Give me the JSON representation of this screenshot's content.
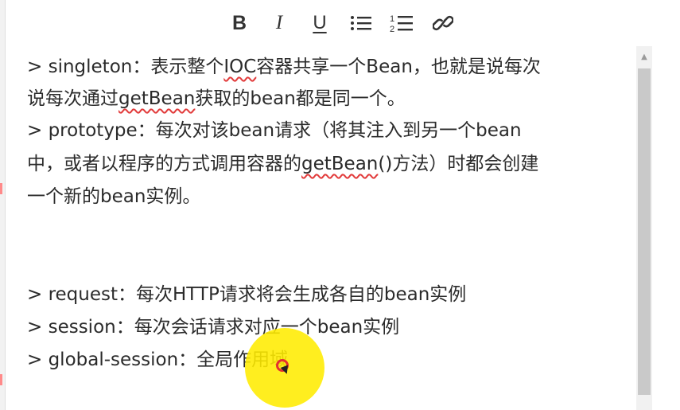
{
  "toolbar": {
    "bold_label": "B",
    "italic_label": "I",
    "underline_label": "U",
    "bulleted_list_icon": "bulleted-list-icon",
    "numbered_list_icon": "numbered-list-icon",
    "link_icon": "link-icon"
  },
  "editor": {
    "lines": [
      {
        "segments": [
          "> singleton：表示整个",
          "IOC",
          "容器共享一个Bean，也就是说每次"
        ]
      },
      {
        "segments": [
          "说每次通过",
          "getBean",
          "获取的bean都是同一个。"
        ]
      },
      {
        "segments": [
          "> prototype：每次对该bean请求（将其注入到另一个bean"
        ]
      },
      {
        "segments": [
          "中，或者以程序的方式调用容器的",
          "getBean",
          "()方法）时都会创建"
        ]
      },
      {
        "segments": [
          "一个新的bean实例。"
        ]
      },
      {
        "segments": [
          "> request：每次HTTP请求将会生成各自的bean实例"
        ]
      },
      {
        "segments": [
          "> session：每次会话请求对应一个bean实例"
        ]
      },
      {
        "segments": [
          "> global-session：全局作用域"
        ]
      }
    ]
  },
  "colors": {
    "spellcheck_underline": "#e23b3b",
    "cursor_highlight": "#ffec00",
    "text": "#2b2b2b"
  }
}
